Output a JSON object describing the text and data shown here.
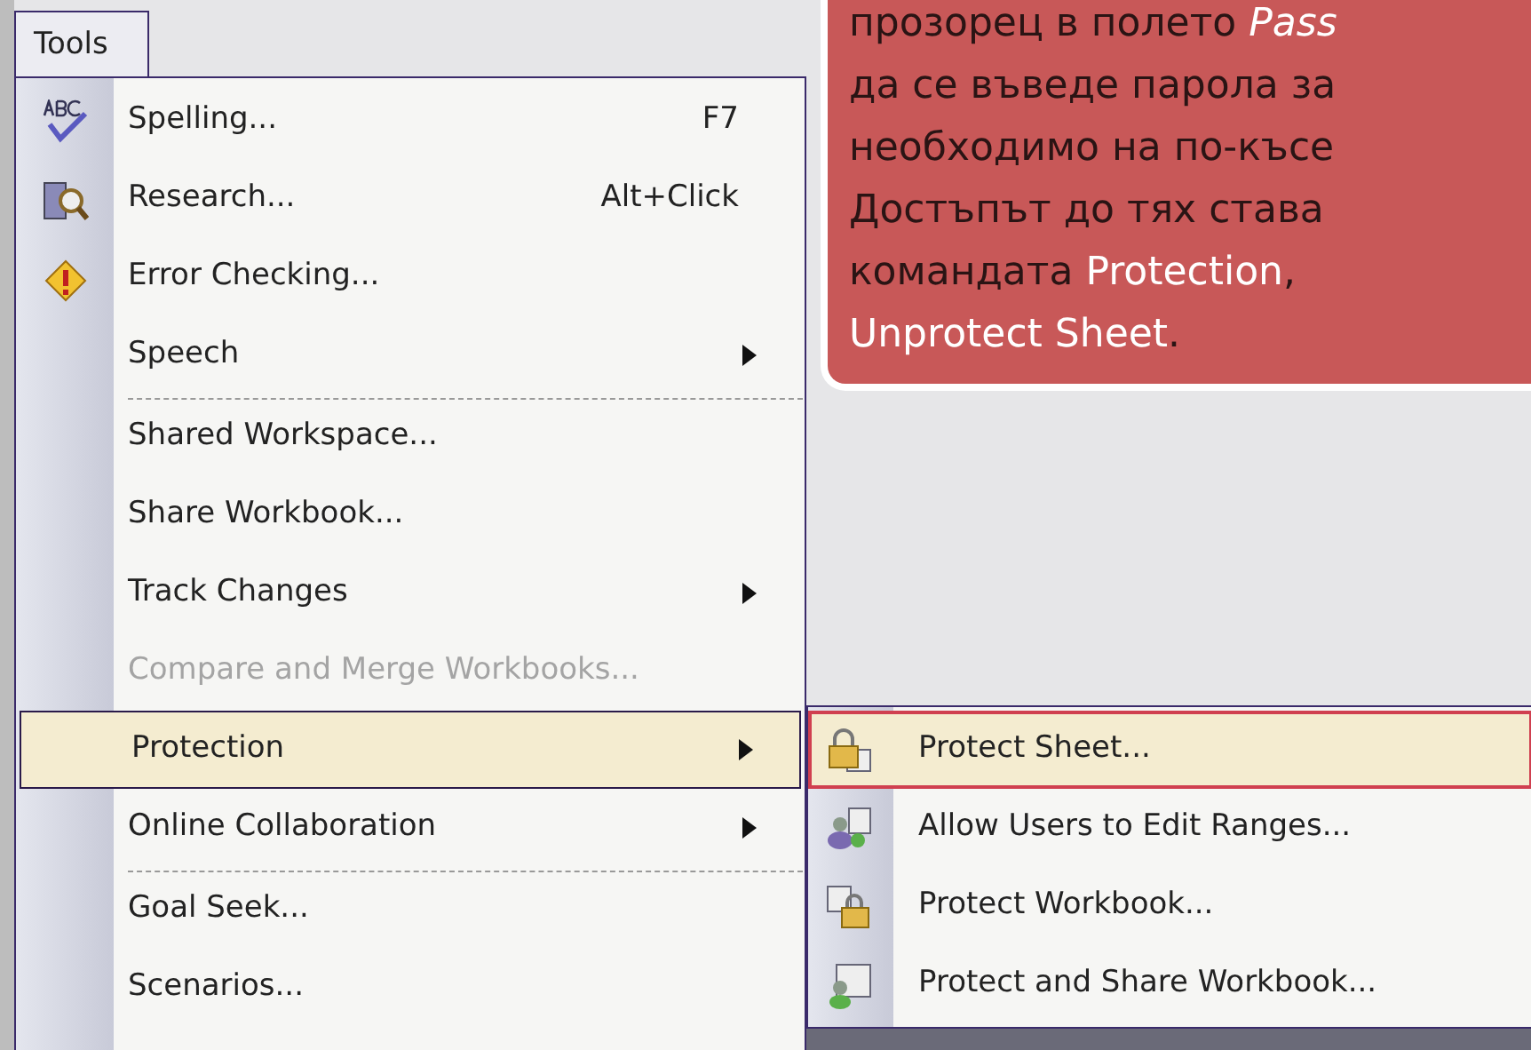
{
  "menu_bar": {
    "label": "Tools"
  },
  "menu_items": [
    {
      "label": "Spelling...",
      "shortcut": "F7",
      "has_submenu": false,
      "disabled": false,
      "selected": false,
      "separator_before": false
    },
    {
      "label": "Research...",
      "shortcut": "Alt+Click",
      "has_submenu": false,
      "disabled": false,
      "selected": false,
      "separator_before": false
    },
    {
      "label": "Error Checking...",
      "has_submenu": false,
      "disabled": false,
      "selected": false,
      "separator_before": false
    },
    {
      "label": "Speech",
      "has_submenu": true,
      "disabled": false,
      "selected": false,
      "separator_before": false
    },
    {
      "label": "Shared Workspace...",
      "has_submenu": false,
      "disabled": false,
      "selected": false,
      "separator_before": true
    },
    {
      "label": "Share Workbook...",
      "has_submenu": false,
      "disabled": false,
      "selected": false,
      "separator_before": false
    },
    {
      "label": "Track Changes",
      "has_submenu": true,
      "disabled": false,
      "selected": false,
      "separator_before": false
    },
    {
      "label": "Compare and Merge Workbooks...",
      "has_submenu": false,
      "disabled": true,
      "selected": false,
      "separator_before": false
    },
    {
      "label": "Protection",
      "has_submenu": true,
      "disabled": false,
      "selected": true,
      "separator_before": false
    },
    {
      "label": "Online Collaboration",
      "has_submenu": true,
      "disabled": false,
      "selected": false,
      "separator_before": false
    },
    {
      "label": "Goal Seek...",
      "has_submenu": false,
      "disabled": false,
      "selected": false,
      "separator_before": true
    },
    {
      "label": "Scenarios...",
      "has_submenu": false,
      "disabled": false,
      "selected": false,
      "separator_before": false
    }
  ],
  "submenu_items": [
    {
      "label": "Protect Sheet...",
      "selected": true
    },
    {
      "label": "Allow Users to Edit Ranges...",
      "selected": false
    },
    {
      "label": "Protect Workbook...",
      "selected": false
    },
    {
      "label": "Protect and Share Workbook...",
      "selected": false
    }
  ],
  "callout": {
    "lines": [
      [
        {
          "text": "прозорец в полето ",
          "kind": "plain"
        },
        {
          "text": "Pass",
          "kind": "italic"
        }
      ],
      [
        {
          "text": "да се въведе парола за",
          "kind": "plain"
        }
      ],
      [
        {
          "text": "необходимо на по-късе",
          "kind": "plain"
        }
      ],
      [
        {
          "text": "Достъпът до тях става",
          "kind": "plain"
        }
      ],
      [
        {
          "text": "командата ",
          "kind": "plain"
        },
        {
          "text": "Protection",
          "kind": "highlight"
        },
        {
          "text": ",",
          "kind": "plain"
        }
      ],
      [
        {
          "text": "Unprotect Sheet",
          "kind": "highlight"
        },
        {
          "text": ".",
          "kind": "plain"
        }
      ]
    ]
  }
}
